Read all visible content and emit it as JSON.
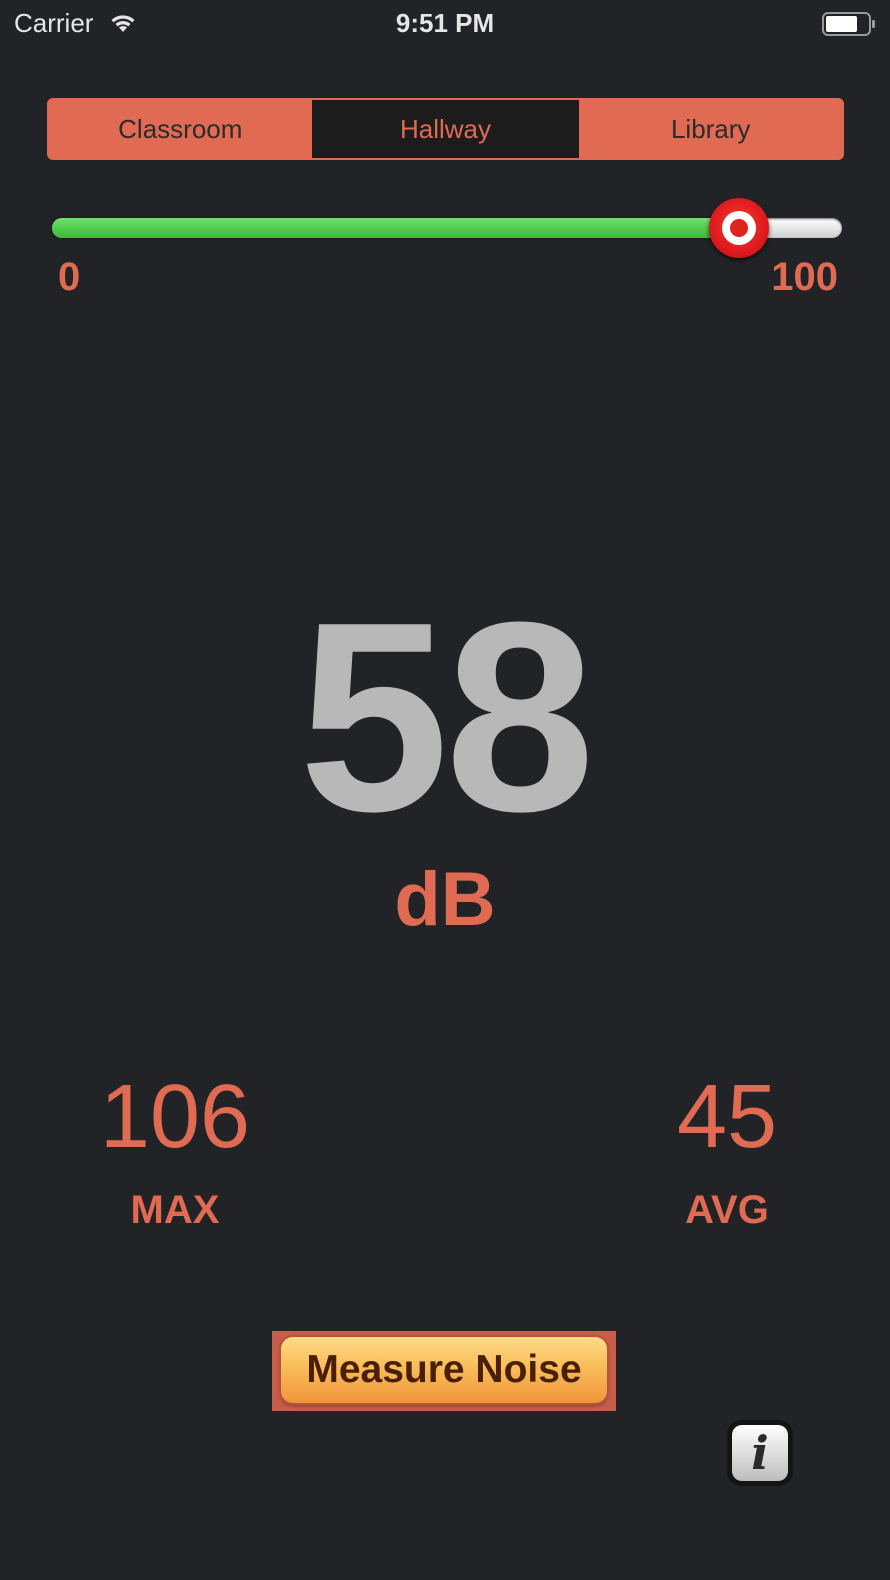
{
  "status_bar": {
    "carrier": "Carrier",
    "time": "9:51 PM",
    "icons": [
      "wifi-icon",
      "battery-icon"
    ]
  },
  "segmented_control": {
    "segments": [
      "Classroom",
      "Hallway",
      "Library"
    ],
    "selected_index": 1
  },
  "threshold_slider": {
    "min_label": "0",
    "max_label": "100",
    "min": 0,
    "max": 100,
    "value": 87
  },
  "reading": {
    "value": "58",
    "unit": "dB"
  },
  "stats": {
    "max_value": "106",
    "max_label": "MAX",
    "avg_value": "45",
    "avg_label": "AVG"
  },
  "measure_button": {
    "label": "Measure Noise"
  },
  "info_button": {
    "icon": "info-icon",
    "glyph": "i"
  },
  "colors": {
    "background": "#222326",
    "accent": "#e06b52",
    "reading": "#b8b8b8",
    "slider_fill": "#4ccb48",
    "slider_thumb": "#e0231f"
  }
}
